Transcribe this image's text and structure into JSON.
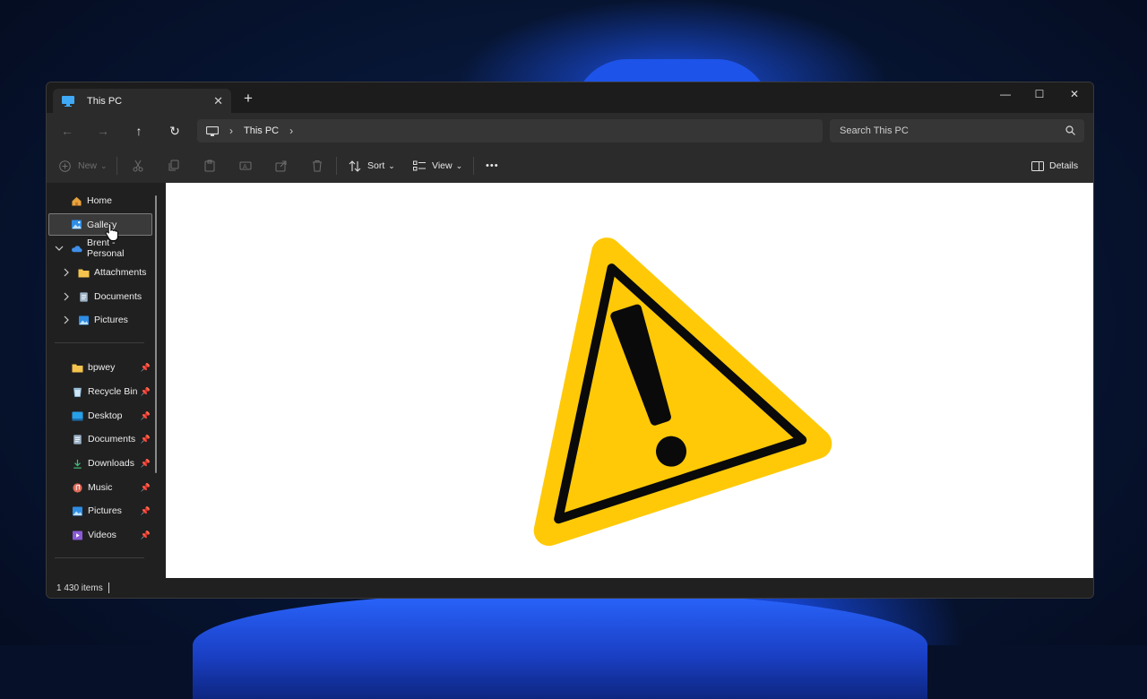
{
  "window": {
    "tab_title": "This PC",
    "tab_close": "✕",
    "tab_add": "+",
    "controls": {
      "minimize": "—",
      "maximize": "☐",
      "close": "✕"
    }
  },
  "nav": {
    "back": "←",
    "forward": "→",
    "up": "↑",
    "refresh": "↻"
  },
  "address": {
    "separator": "›",
    "crumb": "This PC",
    "trailing": "›"
  },
  "search": {
    "placeholder": "Search This PC"
  },
  "toolbar": {
    "new_label": "New",
    "sort_label": "Sort",
    "view_label": "View",
    "more_label": "•••",
    "details_label": "Details",
    "dropdown": "⌄"
  },
  "sidebar": {
    "top": [
      {
        "label": "Home",
        "icon": "home-icon"
      },
      {
        "label": "Gallery",
        "icon": "gallery-icon",
        "selected": true
      },
      {
        "label": "Brent - Personal",
        "icon": "onedrive-icon",
        "expanded": true
      }
    ],
    "onedrive_children": [
      {
        "label": "Attachments",
        "icon": "folder-icon"
      },
      {
        "label": "Documents",
        "icon": "documents-icon"
      },
      {
        "label": "Pictures",
        "icon": "pictures-icon"
      }
    ],
    "pinned": [
      {
        "label": "bpwey",
        "icon": "folder-icon"
      },
      {
        "label": "Recycle Bin",
        "icon": "recycle-bin-icon"
      },
      {
        "label": "Desktop",
        "icon": "desktop-icon"
      },
      {
        "label": "Documents",
        "icon": "documents-icon"
      },
      {
        "label": "Downloads",
        "icon": "downloads-icon"
      },
      {
        "label": "Music",
        "icon": "music-icon"
      },
      {
        "label": "Pictures",
        "icon": "pictures-icon"
      },
      {
        "label": "Videos",
        "icon": "videos-icon"
      }
    ],
    "pin_glyph": "📌"
  },
  "status": {
    "items": "1 430 items"
  },
  "colors": {
    "warning_yellow": "#FFC907",
    "warning_black": "#0a0a0a",
    "accent_blue": "#1d53e8"
  }
}
